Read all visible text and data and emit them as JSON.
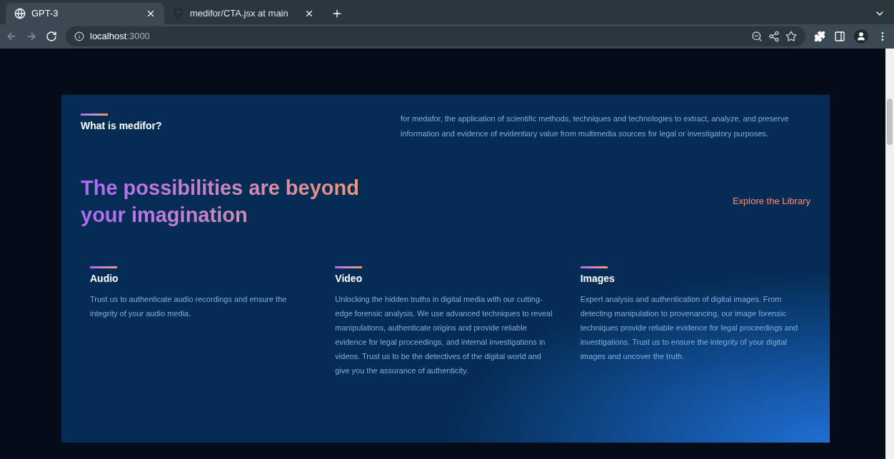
{
  "browser": {
    "tabs": [
      {
        "title": "GPT-3",
        "selected": true,
        "kind": "globe"
      },
      {
        "title": "medifor/CTA.jsx at main",
        "selected": false,
        "kind": "github"
      }
    ],
    "address": {
      "host": "localhost",
      "port": ":3000"
    }
  },
  "intro": {
    "heading": "What is medifor?",
    "text": "for medafor, the application of scientific methods, techniques and technologies to extract, analyze, and preserve information and evidence of evidentiary value from multimedia sources for legal or investigatory purposes."
  },
  "headline": {
    "title": "The possibilities are beyond your imagination",
    "link": "Explore the Library"
  },
  "features": [
    {
      "title": "Audio",
      "text": "Trust us to authenticate audio recordings and ensure the integrity of your audio media."
    },
    {
      "title": "Video",
      "text": "Unlocking the hidden truths in digital media with our cutting-edge forensic analysis. We use advanced techniques to reveal manipulations, authenticate origins and provide reliable evidence for legal proceedings, and internal investigations in videos. Trust us to be the detectives of the digital world and give you the assurance of authenticity."
    },
    {
      "title": "Images",
      "text": "Expert analysis and authentication of digital images. From detecting manipulation to provenancing, our image forensic techniques provide reliable evidence for legal proceedings and investigations. Trust us to ensure the integrity of your digital images and uncover the truth."
    }
  ]
}
